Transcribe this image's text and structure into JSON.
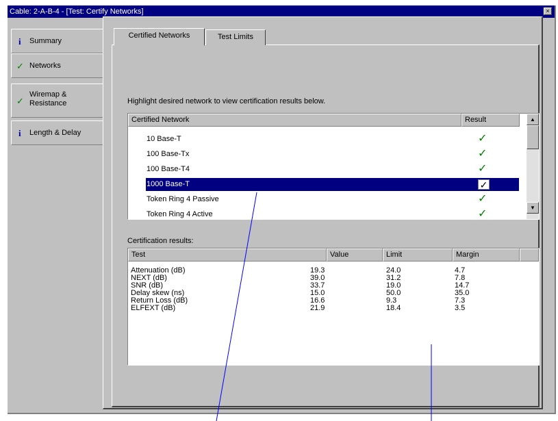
{
  "window": {
    "title": "Cable: 2-A-B-4 - [Test: Certify Networks]",
    "close_glyph": "×"
  },
  "left_tabs": [
    {
      "label": "Summary",
      "icon": "info-icon",
      "glyph": "i"
    },
    {
      "label": "Networks",
      "icon": "check-icon",
      "glyph": "✓",
      "active": true
    },
    {
      "label_line1": "Wiremap &",
      "label_line2": "Resistance",
      "icon": "check-icon",
      "glyph": "✓"
    },
    {
      "label": "Length & Delay",
      "icon": "info-icon",
      "glyph": "i"
    }
  ],
  "top_tabs": [
    {
      "label": "Certified Networks",
      "active": true
    },
    {
      "label": "Test Limits"
    }
  ],
  "instruction": "Highlight desired network to view certification results below.",
  "network_list": {
    "columns": [
      "Certified Network",
      "Result"
    ],
    "rows": [
      {
        "name": "10 Base-T",
        "result": "✓"
      },
      {
        "name": "100 Base-Tx",
        "result": "✓"
      },
      {
        "name": "100 Base-T4",
        "result": "✓"
      },
      {
        "name": "1000 Base-T",
        "result": "✓",
        "selected": true
      },
      {
        "name": "Token Ring 4 Passive",
        "result": "✓"
      },
      {
        "name": "Token Ring 4 Active",
        "result": "✓"
      }
    ],
    "scroll_up": "▲",
    "scroll_down": "▼"
  },
  "results": {
    "label": "Certification results:",
    "columns": [
      "Test",
      "Value",
      "Limit",
      "Margin"
    ],
    "rows": [
      {
        "test": "Attenuation (dB)",
        "value": "19.3",
        "limit": "24.0",
        "margin": "4.7"
      },
      {
        "test": "NEXT (dB)",
        "value": "39.0",
        "limit": "31.2",
        "margin": "7.8"
      },
      {
        "test": "SNR (dB)",
        "value": "33.7",
        "limit": "19.0",
        "margin": "14.7"
      },
      {
        "test": "Delay skew (ns)",
        "value": "15.0",
        "limit": "50.0",
        "margin": "35.0"
      },
      {
        "test": "Return Loss (dB)",
        "value": "16.6",
        "limit": "9.3",
        "margin": "7.3"
      },
      {
        "test": "ELFEXT (dB)",
        "value": "21.9",
        "limit": "18.4",
        "margin": "3.5"
      }
    ]
  },
  "colors": {
    "titlebar": "#000080",
    "selection": "#000080",
    "check": "#008000",
    "callout": "#0000ff",
    "face": "#c0c0c0"
  }
}
